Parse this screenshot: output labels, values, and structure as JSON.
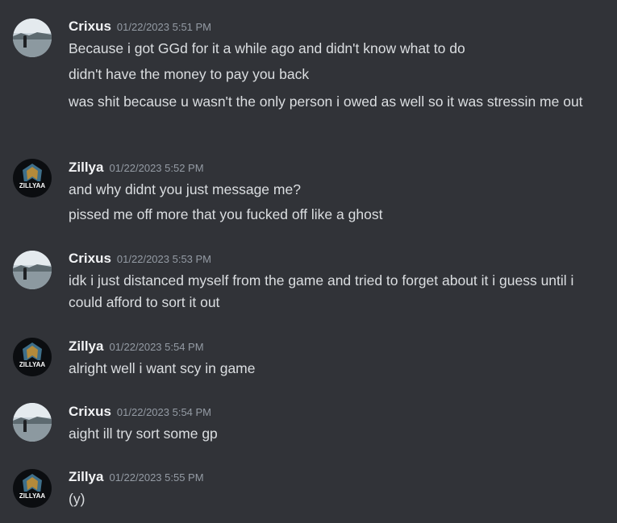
{
  "messages": [
    {
      "author": "Crixus",
      "avatar_icon": "lake-landscape-avatar",
      "timestamp": "01/22/2023 5:51 PM",
      "lines": [
        "Because i got GGd for it a while ago and didn't know what to do",
        "didn't have the money to pay you back",
        "was shit because u wasn't the only person i owed as well so it was stressin me out"
      ]
    },
    {
      "author": "Zillya",
      "avatar_icon": "zillyaa-logo-avatar",
      "avatar_text": "ZILLYAA",
      "timestamp": "01/22/2023 5:52 PM",
      "lines": [
        "and why didnt you just message me?",
        "pissed me off more that you fucked off like a ghost"
      ]
    },
    {
      "author": "Crixus",
      "avatar_icon": "lake-landscape-avatar",
      "timestamp": "01/22/2023 5:53 PM",
      "lines": [
        "idk i just distanced myself from the game and tried to forget about it i guess until i could afford to sort it out"
      ]
    },
    {
      "author": "Zillya",
      "avatar_icon": "zillyaa-logo-avatar",
      "avatar_text": "ZILLYAA",
      "timestamp": "01/22/2023 5:54 PM",
      "lines": [
        "alright well i want scy in game"
      ]
    },
    {
      "author": "Crixus",
      "avatar_icon": "lake-landscape-avatar",
      "timestamp": "01/22/2023 5:54 PM",
      "lines": [
        "aight ill try sort some gp"
      ]
    },
    {
      "author": "Zillya",
      "avatar_icon": "zillyaa-logo-avatar",
      "avatar_text": "ZILLYAA",
      "timestamp": "01/22/2023 5:55 PM",
      "lines": [
        "(y)"
      ]
    }
  ],
  "colors": {
    "background": "#313338",
    "username": "#f2f3f5",
    "timestamp": "#949ba4",
    "message_text": "#dbdee1"
  }
}
